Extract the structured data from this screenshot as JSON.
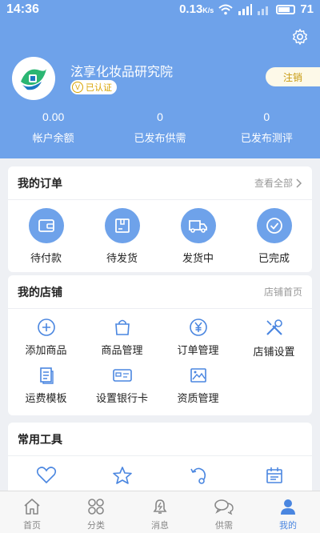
{
  "status_bar": {
    "time": "14:36",
    "speed": "0.13",
    "speed_unit": "K/s",
    "battery": "71"
  },
  "profile": {
    "shop_name": "泫享化妆品研究院",
    "verified_label": "已认证",
    "logout_label": "注销"
  },
  "stats": [
    {
      "value": "0.00",
      "label": "帐户余额"
    },
    {
      "value": "0",
      "label": "已发布供需"
    },
    {
      "value": "0",
      "label": "已发布测评"
    }
  ],
  "orders": {
    "title": "我的订单",
    "view_all": "查看全部",
    "items": [
      {
        "label": "待付款",
        "icon": "wallet-icon"
      },
      {
        "label": "待发货",
        "icon": "package-icon"
      },
      {
        "label": "发货中",
        "icon": "truck-icon"
      },
      {
        "label": "已完成",
        "icon": "check-circle-icon"
      }
    ]
  },
  "shop": {
    "title": "我的店铺",
    "home_link": "店铺首页",
    "items": [
      {
        "label": "添加商品",
        "icon": "plus-circle-icon"
      },
      {
        "label": "商品管理",
        "icon": "shopping-bag-icon"
      },
      {
        "label": "订单管理",
        "icon": "yen-icon"
      },
      {
        "label": "店铺设置",
        "icon": "tools-icon"
      },
      {
        "label": "运费模板",
        "icon": "document-icon"
      },
      {
        "label": "设置银行卡",
        "icon": "bank-card-icon"
      },
      {
        "label": "资质管理",
        "icon": "image-icon"
      }
    ]
  },
  "tools": {
    "title": "常用工具",
    "items": [
      {
        "icon": "heart-icon"
      },
      {
        "icon": "star-icon"
      },
      {
        "icon": "refresh-icon"
      },
      {
        "icon": "calendar-icon"
      }
    ]
  },
  "bottom_nav": [
    {
      "label": "首页",
      "icon": "home-icon",
      "active": false
    },
    {
      "label": "分类",
      "icon": "category-icon",
      "active": false
    },
    {
      "label": "消息",
      "icon": "bell-icon",
      "active": false
    },
    {
      "label": "供需",
      "icon": "chat-icon",
      "active": false
    },
    {
      "label": "我的",
      "icon": "user-icon",
      "active": true
    }
  ],
  "colors": {
    "primary": "#6ea2ea",
    "active_nav": "#4a86e0",
    "verified": "#d8a300"
  }
}
